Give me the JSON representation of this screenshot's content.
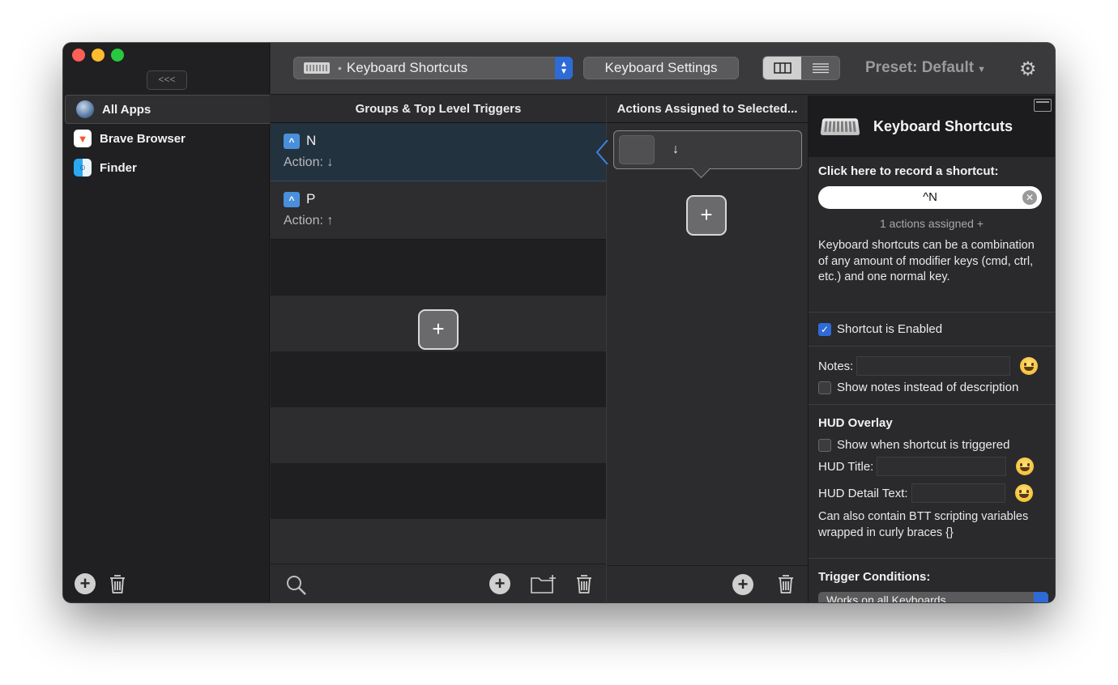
{
  "sidebar": {
    "collapse_label": "<<<",
    "apps": [
      {
        "name": "All Apps",
        "icon": "globe-icon",
        "selected": true
      },
      {
        "name": "Brave Browser",
        "icon": "brave-icon"
      },
      {
        "name": "Finder",
        "icon": "finder-icon"
      }
    ]
  },
  "toolbar": {
    "trigger_type": "Keyboard Shortcuts",
    "keyboard_settings_label": "Keyboard Settings",
    "preset_label": "Preset: Default",
    "view_mode": "columns"
  },
  "groups": {
    "header": "Groups & Top Level Triggers",
    "triggers": [
      {
        "key_badge": "^",
        "key": "N",
        "action": "Action: ↓",
        "selected": true
      },
      {
        "key_badge": "^",
        "key": "P",
        "action": "Action: ↑"
      }
    ],
    "add_label": "+"
  },
  "actions": {
    "header": "Actions Assigned to Selected...",
    "items": [
      {
        "symbol": "↓"
      }
    ],
    "add_label": "+"
  },
  "inspector": {
    "title": "Keyboard Shortcuts",
    "record_label": "Click here to record a shortcut:",
    "shortcut_value": "^N",
    "assigned_text": "1 actions assigned +",
    "description": "Keyboard shortcuts can be a combination of any amount of modifier keys (cmd, ctrl, etc.) and one normal key.",
    "enabled_label": "Shortcut is Enabled",
    "enabled": true,
    "notes_label": "Notes:",
    "notes_value": "",
    "show_notes_label": "Show notes instead of description",
    "show_notes": false,
    "hud_heading": "HUD Overlay",
    "hud_show_label": "Show when shortcut is triggered",
    "hud_show": false,
    "hud_title_label": "HUD Title:",
    "hud_title_value": "",
    "hud_detail_label": "HUD Detail Text:",
    "hud_detail_value": "",
    "hud_note": "Can also contain BTT scripting variables wrapped in curly braces {}",
    "conditions_heading": "Trigger Conditions:",
    "conditions_value": "Works on all Keyboards"
  },
  "colors": {
    "accent": "#2e6bd6",
    "window_bg": "#2a2a2c",
    "selected_row": "#23323f"
  }
}
